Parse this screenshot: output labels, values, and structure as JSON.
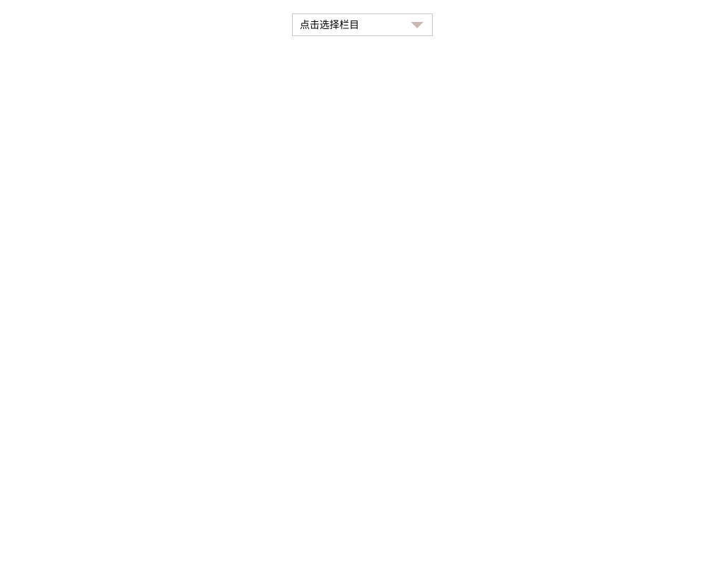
{
  "dropdown": {
    "label": "点击选择栏目"
  }
}
